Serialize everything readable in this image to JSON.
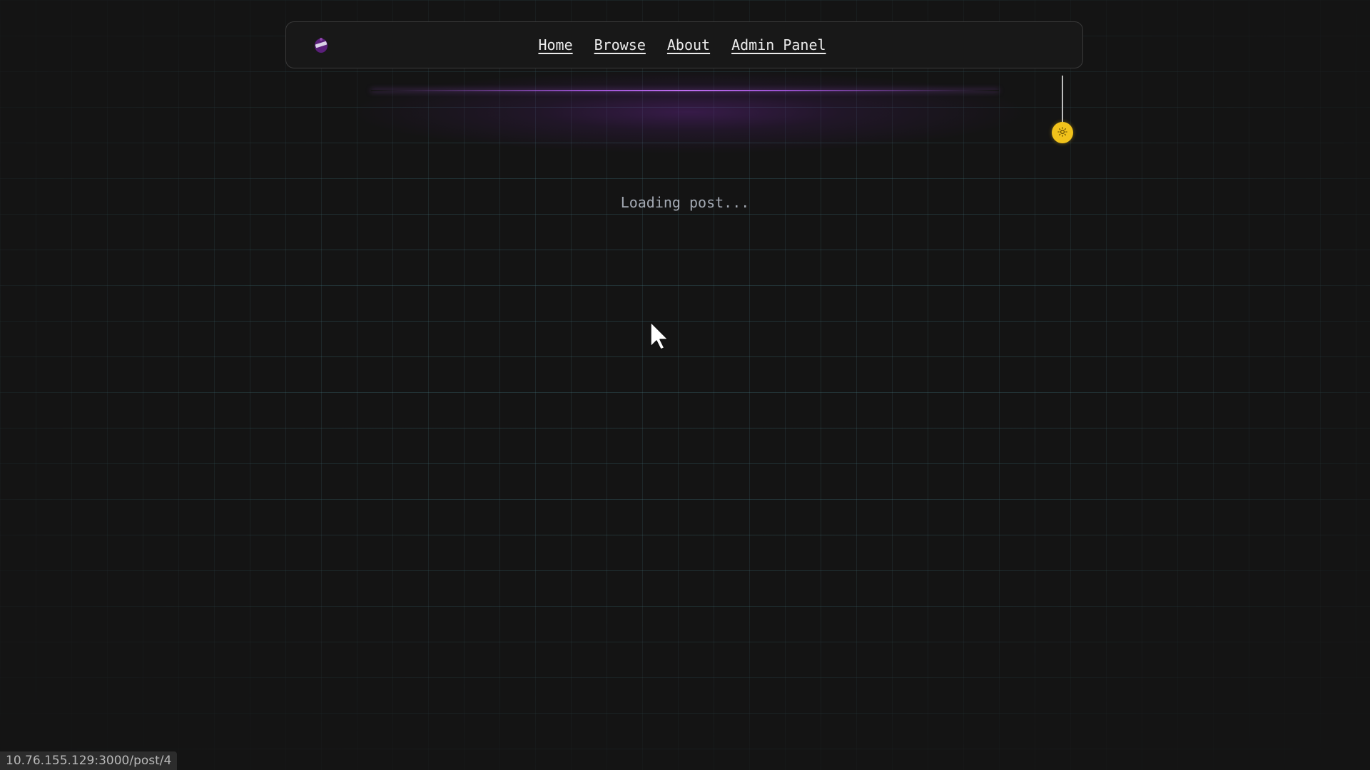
{
  "nav": {
    "logo": "logo-icon",
    "links": {
      "home": "Home",
      "browse": "Browse",
      "about": "About",
      "admin": "Admin Panel"
    }
  },
  "theme_toggle": {
    "icon": "sun-icon",
    "color": "#f1c21b"
  },
  "main": {
    "loading_text": "Loading post..."
  },
  "status_bar": {
    "url": "10.76.155.129:3000/post/4"
  },
  "colors": {
    "background": "#141414",
    "accent": "#a855f7",
    "grid": "#2f5a62"
  }
}
